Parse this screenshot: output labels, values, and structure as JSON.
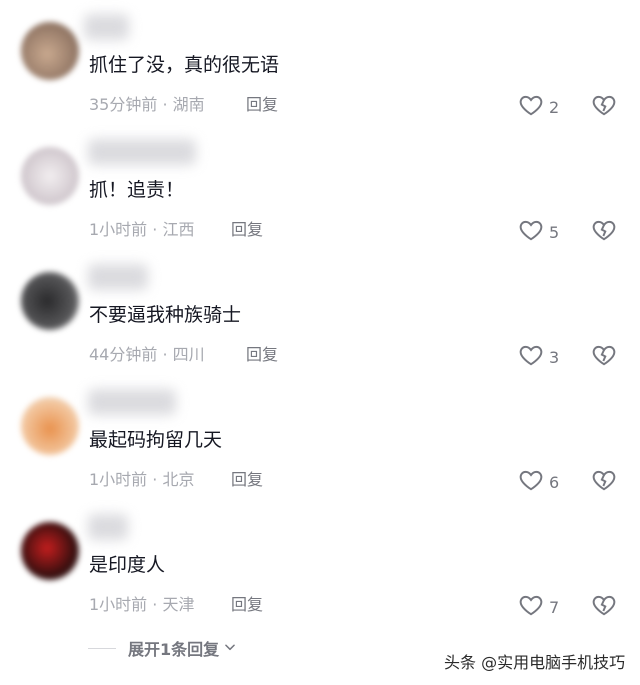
{
  "comments": [
    {
      "text": "抓住了没，真的很无语",
      "meta": "35分钟前 · 湖南",
      "reply": "回复",
      "likes": "2",
      "avatar_color": "#b89a83"
    },
    {
      "text": "抓！追责！",
      "meta": "1小时前 · 江西",
      "reply": "回复",
      "likes": "5",
      "avatar_color": "#d8d2d6"
    },
    {
      "text": "不要逼我种族骑士",
      "meta": "44分钟前 · 四川",
      "reply": "回复",
      "likes": "3",
      "avatar_color": "#4a4a4c"
    },
    {
      "text": "最起码拘留几天",
      "meta": "1小时前 · 北京",
      "reply": "回复",
      "likes": "6",
      "avatar_color": "#e7a46b"
    },
    {
      "text": "是印度人",
      "meta": "1小时前 · 天津",
      "reply": "回复",
      "likes": "7",
      "avatar_color": "#7a1b1b"
    }
  ],
  "expand_replies": "展开1条回复",
  "watermark": "头条 @实用电脑手机技巧",
  "colors": {
    "text": "#161823",
    "meta": "#a7a9b0",
    "action": "#75777f"
  },
  "icons": {
    "like": "heart-outline-icon",
    "dislike": "broken-heart-icon",
    "expand": "chevron-down-icon"
  }
}
